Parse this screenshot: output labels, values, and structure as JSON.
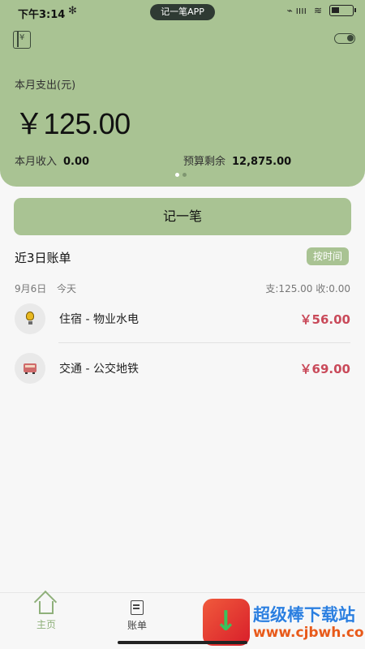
{
  "status_bar": {
    "time": "下午3:14",
    "app_pill": "记一笔APP",
    "bluetooth": "✻",
    "signal": "⌁ ıııı",
    "wifi": "≋"
  },
  "header": {
    "spend_label": "本月支出(元)",
    "spend_amount": "￥125.00",
    "income_label": "本月收入",
    "income_value": "0.00",
    "budget_label": "预算剩余",
    "budget_value": "12,875.00",
    "book_icon_glyph": "¥"
  },
  "record_button": "记一笔",
  "bills": {
    "title": "近3日账单",
    "sort_tag": "按时间",
    "day": {
      "date": "9月6日",
      "label": "今天",
      "summary": "支:125.00  收:0.00"
    },
    "items": [
      {
        "title": "住宿 - 物业水电",
        "amount": "￥56.00",
        "icon": "lightbulb-icon"
      },
      {
        "title": "交通 - 公交地铁",
        "amount": "￥69.00",
        "icon": "bus-icon"
      }
    ]
  },
  "nav": {
    "home": "主页",
    "bill": "账单"
  },
  "watermark": {
    "text": "超级棒下载站",
    "url": "www.cjbwh.com"
  },
  "colors": {
    "accent": "#a9c393",
    "expense": "#c94a5a"
  }
}
